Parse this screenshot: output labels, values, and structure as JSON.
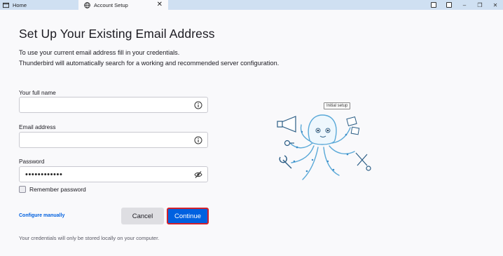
{
  "tabs": {
    "home_label": "Home",
    "active_label": "Account Setup",
    "close_glyph": "✕"
  },
  "window_controls": {
    "minimize": "–",
    "maximize": "❐",
    "close": "✕"
  },
  "page": {
    "title": "Set Up Your Existing Email Address",
    "intro_line1": "To use your current email address fill in your credentials.",
    "intro_line2": "Thunderbird will automatically search for a working and recommended server configuration."
  },
  "form": {
    "full_name": {
      "label": "Your full name",
      "value": ""
    },
    "email": {
      "label": "Email address",
      "value": ""
    },
    "password": {
      "label": "Password",
      "value": "••••••••••••"
    },
    "remember_label": "Remember password",
    "remember_checked": false
  },
  "actions": {
    "configure_manually": "Configure manually",
    "cancel": "Cancel",
    "continue": "Continue"
  },
  "footer": {
    "note": "Your credentials will only be stored locally on your computer."
  },
  "illustration": {
    "tooltip": "Initial setup"
  },
  "colors": {
    "accent": "#0061e0",
    "highlight_border": "#d1202c",
    "tabbar": "#cfe0f2",
    "link": "#0060df"
  }
}
